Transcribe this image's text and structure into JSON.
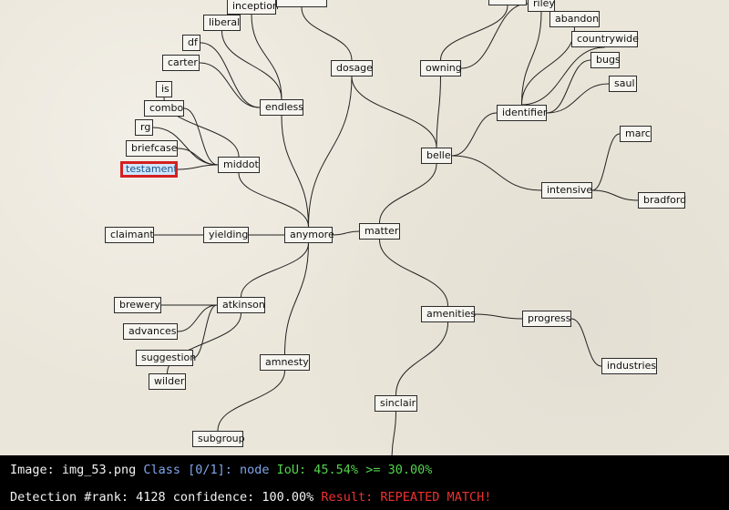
{
  "diagram": {
    "nodes": [
      {
        "id": "inception",
        "label": "inception"
      },
      {
        "id": "top_clip",
        "label": ""
      },
      {
        "id": "liberal",
        "label": "liberal"
      },
      {
        "id": "df",
        "label": "df"
      },
      {
        "id": "carter",
        "label": "carter"
      },
      {
        "id": "endless",
        "label": "endless"
      },
      {
        "id": "is",
        "label": "is"
      },
      {
        "id": "combo",
        "label": "combo"
      },
      {
        "id": "rg",
        "label": "rg"
      },
      {
        "id": "briefcase",
        "label": "briefcase"
      },
      {
        "id": "testament",
        "label": "testament",
        "highlighted": true
      },
      {
        "id": "middot",
        "label": "middot"
      },
      {
        "id": "dosage",
        "label": "dosage"
      },
      {
        "id": "owning",
        "label": "owning"
      },
      {
        "id": "riley",
        "label": "riley"
      },
      {
        "id": "top_right_clip",
        "label": ""
      },
      {
        "id": "abandon",
        "label": "abandon"
      },
      {
        "id": "countrywide",
        "label": "countrywide"
      },
      {
        "id": "bugs",
        "label": "bugs"
      },
      {
        "id": "saul",
        "label": "saul"
      },
      {
        "id": "identifier",
        "label": "identifier"
      },
      {
        "id": "belle",
        "label": "belle"
      },
      {
        "id": "marc",
        "label": "marc"
      },
      {
        "id": "intensive",
        "label": "intensive"
      },
      {
        "id": "bradford",
        "label": "bradford"
      },
      {
        "id": "claimant",
        "label": "claimant"
      },
      {
        "id": "yielding",
        "label": "yielding"
      },
      {
        "id": "anymore",
        "label": "anymore"
      },
      {
        "id": "matter",
        "label": "matter"
      },
      {
        "id": "brewery",
        "label": "brewery"
      },
      {
        "id": "atkinson",
        "label": "atkinson"
      },
      {
        "id": "advances",
        "label": "advances"
      },
      {
        "id": "suggestion",
        "label": "suggestion"
      },
      {
        "id": "wilder",
        "label": "wilder"
      },
      {
        "id": "amnesty",
        "label": "amnesty"
      },
      {
        "id": "subgroup",
        "label": "subgroup"
      },
      {
        "id": "amenities",
        "label": "amenities"
      },
      {
        "id": "progress",
        "label": "progress"
      },
      {
        "id": "industries",
        "label": "industries"
      },
      {
        "id": "sinclair",
        "label": "sinclair"
      }
    ],
    "edges": [
      [
        "matter",
        "anymore"
      ],
      [
        "matter",
        "belle"
      ],
      [
        "matter",
        "amenities"
      ],
      [
        "anymore",
        "yielding"
      ],
      [
        "anymore",
        "middot"
      ],
      [
        "anymore",
        "endless"
      ],
      [
        "anymore",
        "dosage"
      ],
      [
        "anymore",
        "atkinson"
      ],
      [
        "anymore",
        "amnesty"
      ],
      [
        "yielding",
        "claimant"
      ],
      [
        "middot",
        "is"
      ],
      [
        "middot",
        "combo"
      ],
      [
        "middot",
        "rg"
      ],
      [
        "middot",
        "briefcase"
      ],
      [
        "middot",
        "testament"
      ],
      [
        "endless",
        "inception"
      ],
      [
        "endless",
        "liberal"
      ],
      [
        "endless",
        "df"
      ],
      [
        "endless",
        "carter"
      ],
      [
        "dosage",
        "top_clip"
      ],
      [
        "belle",
        "owning"
      ],
      [
        "belle",
        "identifier"
      ],
      [
        "belle",
        "intensive"
      ],
      [
        "belle",
        "dosage"
      ],
      [
        "owning",
        "riley"
      ],
      [
        "owning",
        "top_right_clip"
      ],
      [
        "identifier",
        "abandon"
      ],
      [
        "identifier",
        "countrywide"
      ],
      [
        "identifier",
        "bugs"
      ],
      [
        "identifier",
        "saul"
      ],
      [
        "identifier",
        "riley"
      ],
      [
        "intensive",
        "marc"
      ],
      [
        "intensive",
        "bradford"
      ],
      [
        "atkinson",
        "brewery"
      ],
      [
        "atkinson",
        "advances"
      ],
      [
        "atkinson",
        "suggestion"
      ],
      [
        "atkinson",
        "wilder"
      ],
      [
        "amnesty",
        "subgroup"
      ],
      [
        "amenities",
        "progress"
      ],
      [
        "amenities",
        "sinclair"
      ],
      [
        "progress",
        "industries"
      ],
      [
        "sinclair",
        "bottom_clip"
      ]
    ]
  },
  "detection": {
    "image_label": "Image:",
    "image_name": "img_53.png",
    "class_text": "Class [0/1]: node",
    "iou_text": "IoU: 45.54% >= 30.00%",
    "detection_text": "Detection #rank: 4128 confidence: 100.00%",
    "result_text": "Result: REPEATED MATCH!"
  }
}
